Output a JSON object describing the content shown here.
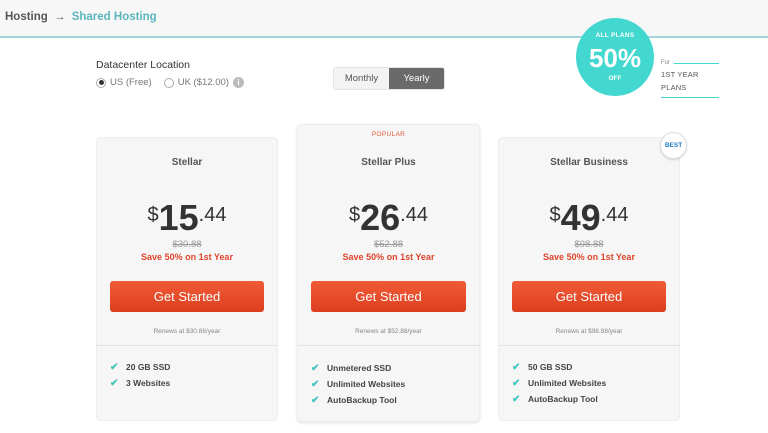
{
  "breadcrumb": {
    "home": "Hosting",
    "arrow": "→",
    "current": "Shared Hosting"
  },
  "datacenter": {
    "label": "Datacenter Location",
    "options": [
      {
        "label": "US (Free)",
        "selected": true
      },
      {
        "label": "UK ($12.00)",
        "selected": false
      }
    ],
    "info_icon": "i"
  },
  "billing_toggle": {
    "monthly": "Monthly",
    "yearly": "Yearly",
    "selected": "Yearly"
  },
  "promo": {
    "top": "ALL PLANS",
    "percent": "50%",
    "off": "OFF",
    "for": "For",
    "line1": "1ST YEAR",
    "line2": "PLANS"
  },
  "plans": [
    {
      "name": "Stellar",
      "currency": "$",
      "price_int": "15",
      "price_dec": ".44",
      "old_price": "$30.88",
      "save": "Save 50% on 1st Year",
      "cta": "Get Started",
      "renews": "Renews at $30.88/year",
      "features": [
        "20 GB SSD",
        "3 Websites"
      ]
    },
    {
      "badge": "POPULAR",
      "name": "Stellar Plus",
      "currency": "$",
      "price_int": "26",
      "price_dec": ".44",
      "old_price": "$52.88",
      "save": "Save 50% on 1st Year",
      "cta": "Get Started",
      "renews": "Renews at $52.88/year",
      "features": [
        "Unmetered SSD",
        "Unlimited Websites",
        "AutoBackup Tool"
      ]
    },
    {
      "badge": "BEST",
      "name": "Stellar Business",
      "currency": "$",
      "price_int": "49",
      "price_dec": ".44",
      "old_price": "$98.88",
      "save": "Save 50% on 1st Year",
      "cta": "Get Started",
      "renews": "Renews at $98.88/year",
      "features": [
        "50 GB SSD",
        "Unlimited Websites",
        "AutoBackup Tool"
      ]
    }
  ],
  "colors": {
    "accent_teal": "#43d8cf",
    "cta_orange": "#e84a2a",
    "save_red": "#e0442a",
    "check": "#43c5bd"
  },
  "icons": {
    "check": "check-icon",
    "info": "info-icon"
  }
}
